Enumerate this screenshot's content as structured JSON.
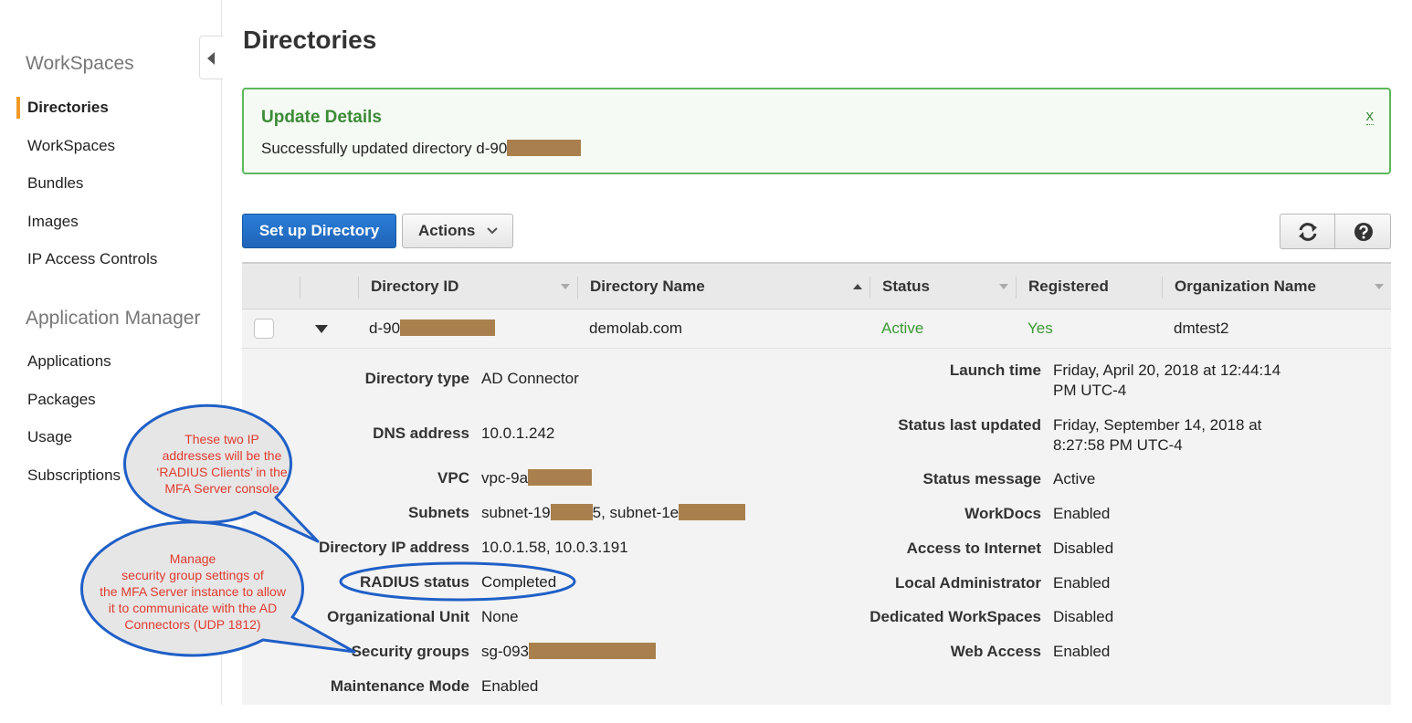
{
  "sidebar": {
    "section1": "WorkSpaces",
    "items1": [
      "Directories",
      "WorkSpaces",
      "Bundles",
      "Images",
      "IP Access Controls"
    ],
    "section2": "Application Manager",
    "items2": [
      "Applications",
      "Packages",
      "Usage",
      "Subscriptions"
    ]
  },
  "page": {
    "title": "Directories"
  },
  "alert": {
    "title": "Update Details",
    "message": "Successfully updated directory d-90",
    "close": "x"
  },
  "toolbar": {
    "setup_label": "Set up Directory",
    "actions_label": "Actions"
  },
  "table": {
    "columns": [
      "Directory ID",
      "Directory Name",
      "Status",
      "Registered",
      "Organization Name"
    ],
    "row": {
      "id": "d-90",
      "name": "demolab.com",
      "status": "Active",
      "registered": "Yes",
      "org": "dmtest2"
    }
  },
  "details": {
    "left": [
      {
        "label": "Directory type",
        "value": "AD Connector"
      },
      {
        "label": "DNS address",
        "value": "10.0.1.242"
      },
      {
        "label": "VPC",
        "value": "vpc-9a"
      },
      {
        "label": "Subnets",
        "value": "subnet-19",
        "value_mid": "5, subnet-1e"
      },
      {
        "label": "Directory IP address",
        "value": "10.0.1.58, 10.0.3.191"
      },
      {
        "label": "RADIUS status",
        "value": "Completed"
      },
      {
        "label": "Organizational Unit",
        "value": "None"
      },
      {
        "label": "Security groups",
        "value": "sg-093"
      },
      {
        "label": "Maintenance Mode",
        "value": "Enabled"
      }
    ],
    "right": [
      {
        "label": "Launch time",
        "value": "Friday, April 20, 2018 at 12:44:14",
        "value2": "PM UTC-4"
      },
      {
        "label": "Status last updated",
        "value": "Friday, September 14, 2018 at",
        "value2": "8:27:58 PM UTC-4"
      },
      {
        "label": "Status message",
        "value": "Active"
      },
      {
        "label": "WorkDocs",
        "value": "Enabled"
      },
      {
        "label": "Access to Internet",
        "value": "Disabled"
      },
      {
        "label": "Local Administrator",
        "value": "Enabled"
      },
      {
        "label": "Dedicated WorkSpaces",
        "value": "Disabled"
      },
      {
        "label": "Web Access",
        "value": "Enabled"
      }
    ]
  },
  "annotations": {
    "callout1": [
      "These two IP",
      "addresses will be the",
      "‘RADIUS Clients’ in the",
      "MFA Server console"
    ],
    "callout2": [
      "Manage",
      "security group settings of",
      "the MFA Server instance to allow",
      "it to communicate with the AD",
      "Connectors (UDP 1812)"
    ]
  },
  "colors": {
    "accent_orange": "#f29b2a",
    "primary_blue": "#1f64b8",
    "success_green": "#3c9b35",
    "annotation_red": "#e03b2f",
    "callout_outline": "#1f5fc7",
    "redaction": "#a9804d"
  },
  "icons": {
    "collapse": "triangle-left-icon",
    "actions_dropdown": "chevron-down-icon",
    "refresh": "refresh-icon",
    "help": "help-icon",
    "expand": "caret-down-icon"
  }
}
